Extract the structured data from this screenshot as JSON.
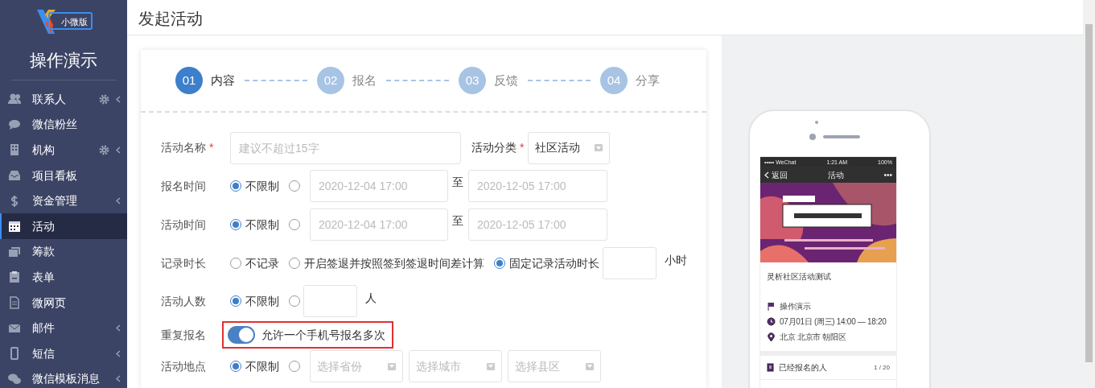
{
  "sidebar": {
    "logo_badge": "小微版",
    "title": "操作演示",
    "items": [
      {
        "label": "联系人",
        "settings": true,
        "expandable": true,
        "selected": false
      },
      {
        "label": "微信粉丝",
        "settings": false,
        "expandable": false,
        "selected": false
      },
      {
        "label": "机构",
        "settings": true,
        "expandable": true,
        "selected": false
      },
      {
        "label": "项目看板",
        "settings": false,
        "expandable": false,
        "selected": false
      },
      {
        "label": "资金管理",
        "settings": false,
        "expandable": true,
        "selected": false
      },
      {
        "label": "活动",
        "settings": false,
        "expandable": false,
        "selected": true
      },
      {
        "label": "筹款",
        "settings": false,
        "expandable": false,
        "selected": false
      },
      {
        "label": "表单",
        "settings": false,
        "expandable": false,
        "selected": false
      },
      {
        "label": "微网页",
        "settings": false,
        "expandable": false,
        "selected": false
      },
      {
        "label": "邮件",
        "settings": false,
        "expandable": true,
        "selected": false
      },
      {
        "label": "短信",
        "settings": false,
        "expandable": true,
        "selected": false
      },
      {
        "label": "微信模板消息",
        "settings": false,
        "expandable": true,
        "selected": false
      }
    ]
  },
  "page_title": "发起活动",
  "steps": [
    {
      "number": "01",
      "label": "内容",
      "selected": true
    },
    {
      "number": "02",
      "label": "报名",
      "selected": false
    },
    {
      "number": "03",
      "label": "反馈",
      "selected": false
    },
    {
      "number": "04",
      "label": "分享",
      "selected": false
    }
  ],
  "form": [
    {
      "kind": "name",
      "label": "活动名称",
      "required_mark": "*",
      "placeholder": "建议不超过15字",
      "category_label": "活动分类",
      "category_required_mark": "*",
      "category_value": "社区活动"
    },
    {
      "kind": "range",
      "label": "报名时间",
      "options": [
        {
          "label": "不限制",
          "selected": true
        },
        {
          "selected": false
        }
      ],
      "from_placeholder": "2020-12-04 17:00",
      "separator": "至",
      "to_placeholder": "2020-12-05 17:00"
    },
    {
      "kind": "range",
      "label": "活动时间",
      "options": [
        {
          "label": "不限制",
          "selected": true
        },
        {
          "selected": false
        }
      ],
      "from_placeholder": "2020-12-04 17:00",
      "separator": "至",
      "to_placeholder": "2020-12-05 17:00"
    },
    {
      "kind": "amount",
      "label": "记录时长",
      "options": [
        {
          "label": "不记录",
          "selected": false
        },
        {
          "label": "开启签退并按照签到签退时间差计算",
          "selected": false
        },
        {
          "label": "固定记录活动时长",
          "selected": true
        }
      ],
      "unit": "小时"
    },
    {
      "kind": "amount",
      "label": "活动人数",
      "options": [
        {
          "label": "不限制",
          "selected": true
        },
        {
          "selected": false
        }
      ],
      "unit": "人"
    },
    {
      "kind": "toggle",
      "label": "重复报名",
      "on": true,
      "highlighted": true,
      "text": "允许一个手机号报名多次"
    },
    {
      "kind": "location",
      "label": "活动地点",
      "options": [
        {
          "label": "不限制",
          "selected": true
        },
        {
          "selected": false
        }
      ],
      "selects": [
        "选择省份",
        "选择城市",
        "选择县区"
      ]
    }
  ],
  "phone": {
    "status_bar": {
      "carrier": "••••• WeChat",
      "time": "1:21 AM",
      "battery": "100%"
    },
    "nav": {
      "back": "返回",
      "title": "活动",
      "more": "•••"
    },
    "event_title": "灵析社区活动测试",
    "details": [
      {
        "kind": "organizer",
        "text": "操作演示"
      },
      {
        "kind": "time",
        "text": "07月01日 (周三) 14:00 — 18:20"
      },
      {
        "kind": "place",
        "text": "北京 北京市 朝阳区"
      }
    ],
    "registrants": {
      "label": "已经报名的人",
      "count": "1 / 20"
    }
  }
}
